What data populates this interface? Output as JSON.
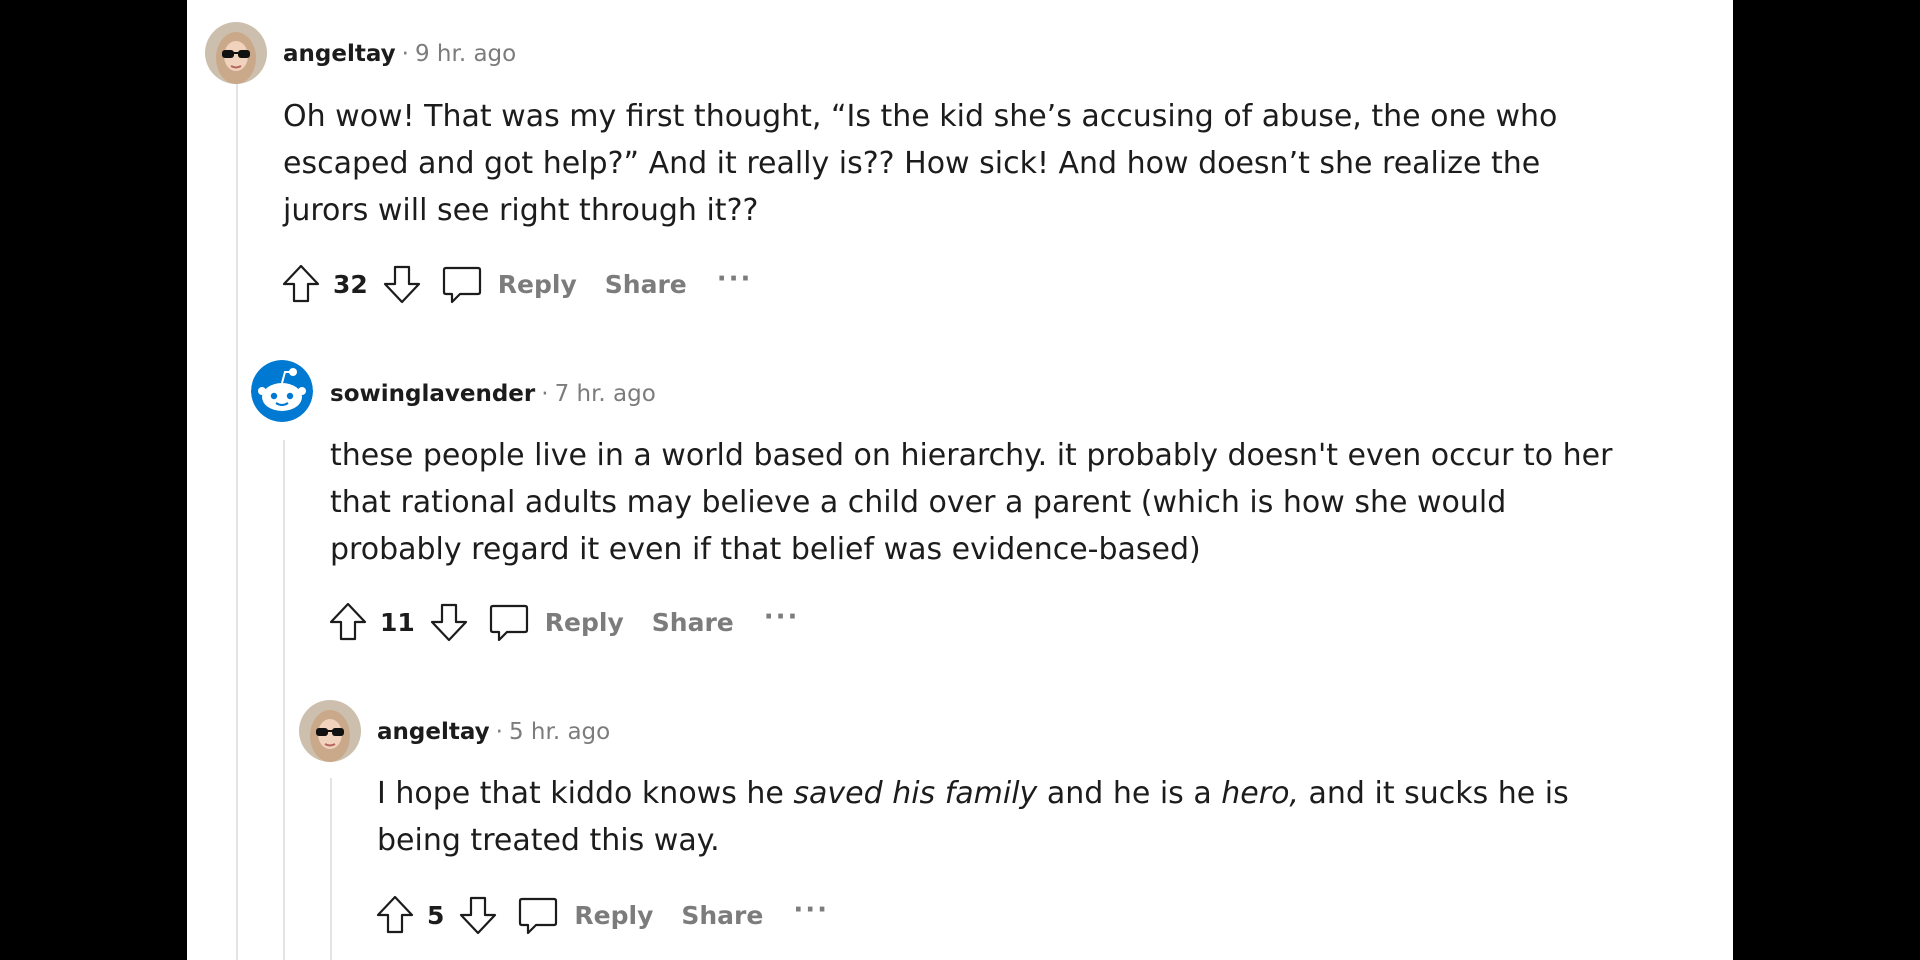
{
  "comments": [
    {
      "author": "angeltay",
      "separator": "·",
      "time": "9 hr. ago",
      "avatar_icon": "profile-photo-sunglasses",
      "body_parts": [
        {
          "text": "Oh wow! That was my first thought, “Is the kid she’s accusing of abuse, the one who escaped and got help?” And it really is?? How sick! And how doesn’t she realize the jurors will see right through it??",
          "italic": false
        }
      ],
      "score": "32",
      "reply_label": "Reply",
      "share_label": "Share",
      "more_label": "···"
    },
    {
      "author": "sowinglavender",
      "separator": "·",
      "time": "7 hr. ago",
      "avatar_icon": "snoo-default-avatar",
      "body_parts": [
        {
          "text": "these people live in a world based on hierarchy. it probably doesn't even occur to her that rational adults may believe a child over a parent (which is how she would probably regard it even if that belief was evidence-based)",
          "italic": false
        }
      ],
      "score": "11",
      "reply_label": "Reply",
      "share_label": "Share",
      "more_label": "···"
    },
    {
      "author": "angeltay",
      "separator": "·",
      "time": "5 hr. ago",
      "avatar_icon": "profile-photo-sunglasses",
      "body_parts": [
        {
          "text": "I hope that kiddo knows he ",
          "italic": false
        },
        {
          "text": "saved his family",
          "italic": true
        },
        {
          "text": " and he is a ",
          "italic": false
        },
        {
          "text": "hero,",
          "italic": true
        },
        {
          "text": " and it sucks he is being treated this way.",
          "italic": false
        }
      ],
      "score": "5",
      "reply_label": "Reply",
      "share_label": "Share",
      "more_label": "···"
    }
  ],
  "colors": {
    "background": "#000000",
    "panel": "#ffffff",
    "text": "#1c1c1c",
    "muted": "#7c7c7c",
    "thread_line": "#e3e3e3",
    "snoo_blue": "#0079d3"
  }
}
